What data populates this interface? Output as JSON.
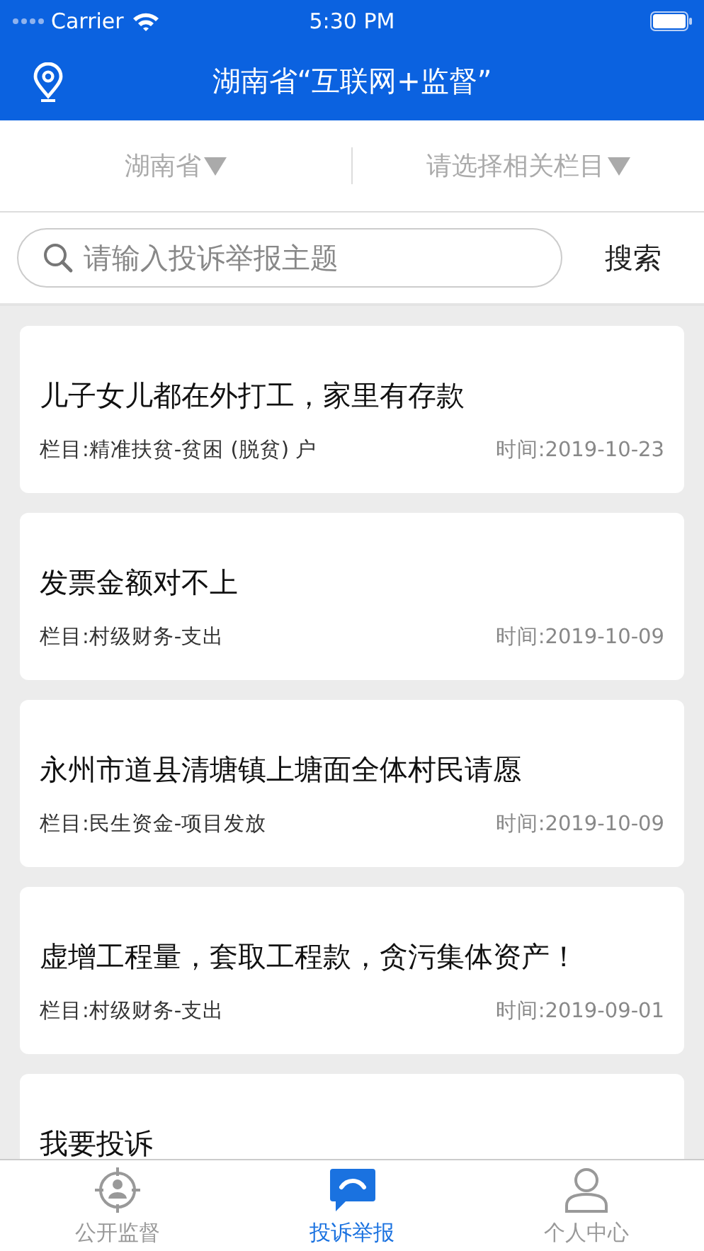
{
  "status_bar": {
    "carrier": "Carrier",
    "time": "5:30 PM"
  },
  "header": {
    "title": "湖南省“互联网+监督”"
  },
  "filters": [
    {
      "label": "湖南省"
    },
    {
      "label": "请选择相关栏目"
    }
  ],
  "search": {
    "placeholder": "请输入投诉举报主题",
    "button": "搜索"
  },
  "posts": [
    {
      "title": "儿子女儿都在外打工，家里有存款",
      "category": "栏目:精准扶贫-贫困 (脱贫) 户",
      "time": "时间:2019-10-23"
    },
    {
      "title": "发票金额对不上",
      "category": "栏目:村级财务-支出",
      "time": "时间:2019-10-09"
    },
    {
      "title": "永州市道县清塘镇上塘面全体村民请愿",
      "category": "栏目:民生资金-项目发放",
      "time": "时间:2019-10-09"
    },
    {
      "title": "虚增工程量，套取工程款，贪污集体资产！",
      "category": "栏目:村级财务-支出",
      "time": "时间:2019-09-01"
    },
    {
      "title": "我要投诉"
    }
  ],
  "tabs": [
    {
      "label": "公开监督",
      "selected": false
    },
    {
      "label": "投诉举报",
      "selected": true
    },
    {
      "label": "个人中心",
      "selected": false
    }
  ]
}
